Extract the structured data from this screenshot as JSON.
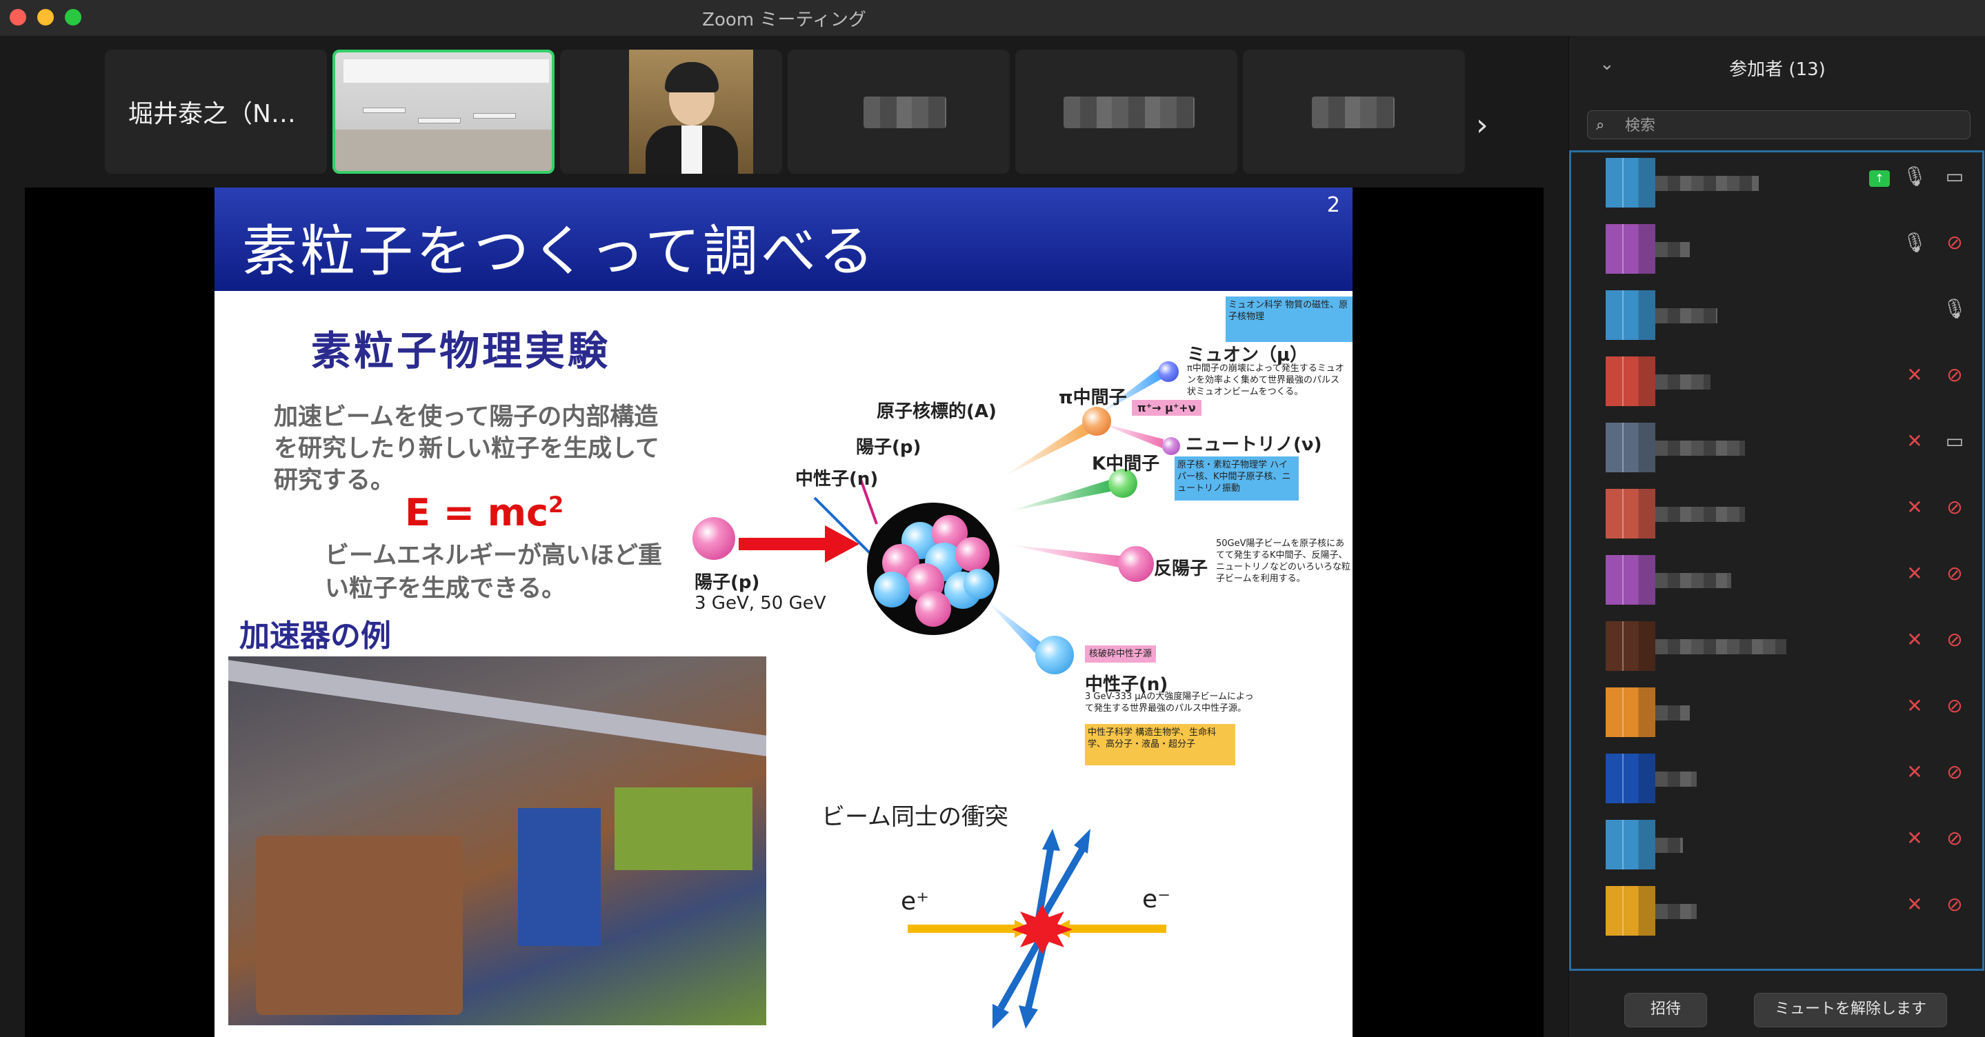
{
  "window": {
    "title": "Zoom ミーティング"
  },
  "strip": {
    "first_name": "堀井泰之（N…"
  },
  "slide": {
    "title": "素粒子をつくって調べる",
    "page_number": "2",
    "experiment_title": "素粒子物理実験",
    "description": "加速ビームを使って陽子の内部構造を研究したり新しい粒子を生成して研究する。",
    "formula_main": "E = mc",
    "formula_sup": "2",
    "description2": "ビームエネルギーが高いほど重い粒子を生成できる。",
    "accelerator_title": "加速器の例",
    "labels": {
      "target": "原子核標的(A)",
      "proton": "陽子(p)",
      "neutron_in": "中性子(n)",
      "beam_proton": "陽子(p)",
      "beam_energy": "3 GeV, 50 GeV",
      "pi_meson": "π中間子",
      "muon": "ミュオン（μ）",
      "neutrino": "ニュートリノ(ν)",
      "k_meson": "K中間子",
      "antiproton": "反陽子",
      "neutron_out": "中性子(n)",
      "decay": "π⁺→ μ⁺+ν",
      "e_plus": "e⁺",
      "e_minus": "e⁻"
    },
    "collision_title": "ビーム同士の衝突",
    "notes": {
      "muon_box": "ミュオン科学 物質の磁性、原子核物理",
      "muon_desc": "π中間子の崩壊によって発生するミュオンを効率よく集めて世界最強のパルス状ミュオンビームをつくる。",
      "neutrino_box": "原子核・素粒子物理学 ハイパー核、K中間子原子核、ニュートリノ振動",
      "antiproton_desc": "50GeV陽子ビームを原子核にあてて発生するK中間子、反陽子、ニュートリノなどのいろいろな粒子ビームを利用する。",
      "spallation_box": "核破砕中性子源",
      "neutron_desc": "3 GeV-333 μAの大強度陽子ビームによって発生する世界最強のパルス中性子源。",
      "neutron_box": "中性子科学 構造生物学、生命科学、高分子・液晶・超分子"
    }
  },
  "sidebar": {
    "title": "参加者 (13)",
    "search_placeholder": "検索",
    "invite_label": "招待",
    "unmute_label": "ミュートを解除します"
  },
  "participants": [
    {
      "avatar_color": "#3a8fc7",
      "name_width": 150,
      "mic": "on",
      "video": "on",
      "sharing": true
    },
    {
      "avatar_color": "#9b4fb0",
      "name_width": 50,
      "mic": "on",
      "video": "off",
      "sharing": false
    },
    {
      "avatar_color": "#3a8fc7",
      "name_width": 90,
      "mic": "on",
      "video": "none",
      "sharing": false
    },
    {
      "avatar_color": "#c8473a",
      "name_width": 80,
      "mic": "off",
      "video": "off",
      "sharing": false
    },
    {
      "avatar_color": "#5a6a80",
      "name_width": 130,
      "mic": "off",
      "video": "on",
      "sharing": false
    },
    {
      "avatar_color": "#c35444",
      "name_width": 130,
      "mic": "off",
      "video": "off",
      "sharing": false
    },
    {
      "avatar_color": "#9b4fb0",
      "name_width": 110,
      "mic": "off",
      "video": "off",
      "sharing": false
    },
    {
      "avatar_color": "#5a3020",
      "name_width": 190,
      "mic": "off",
      "video": "off",
      "sharing": false
    },
    {
      "avatar_color": "#e08a2a",
      "name_width": 50,
      "mic": "off",
      "video": "off",
      "sharing": false
    },
    {
      "avatar_color": "#1a4fb0",
      "name_width": 60,
      "mic": "off",
      "video": "off",
      "sharing": false
    },
    {
      "avatar_color": "#3a8fc7",
      "name_width": 40,
      "mic": "off",
      "video": "off",
      "sharing": false
    },
    {
      "avatar_color": "#e0a020",
      "name_width": 60,
      "mic": "off",
      "video": "off",
      "sharing": false
    }
  ],
  "icons": {
    "mic": "mic-icon",
    "mic_off": "mic-off-icon",
    "video": "video-icon",
    "video_off": "video-off-icon",
    "share": "share-screen-icon",
    "search": "search-icon",
    "chevron": "chevron-down-icon",
    "next": "chevron-right-icon"
  }
}
